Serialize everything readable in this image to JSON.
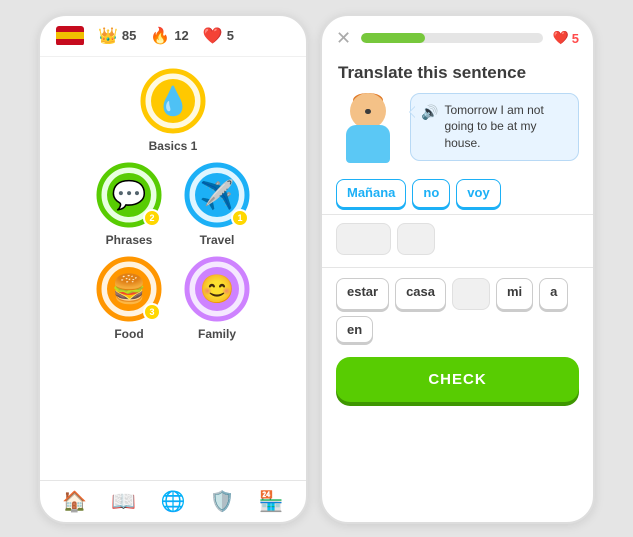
{
  "leftPhone": {
    "topBar": {
      "stats": [
        {
          "id": "xp",
          "icon": "👑",
          "value": "85",
          "iconClass": "crown-icon"
        },
        {
          "id": "streak",
          "icon": "🔥",
          "value": "12",
          "iconClass": "fire-icon"
        },
        {
          "id": "hearts",
          "icon": "❤️",
          "value": "5",
          "iconClass": "heart-icon"
        }
      ]
    },
    "lessons": [
      {
        "row": 1,
        "items": [
          {
            "id": "basics1",
            "name": "Basics 1",
            "icon": "💧",
            "color": "#ffc800",
            "ringColor": "#ffc800",
            "badge": null,
            "single": true
          }
        ]
      },
      {
        "row": 2,
        "items": [
          {
            "id": "phrases",
            "name": "Phrases",
            "icon": "💬",
            "color": "#58cc02",
            "ringColor": "#58cc02",
            "badge": "2"
          },
          {
            "id": "travel",
            "name": "Travel",
            "icon": "✈️",
            "color": "#1cb0f6",
            "ringColor": "#1cb0f6",
            "badge": "1"
          }
        ]
      },
      {
        "row": 3,
        "items": [
          {
            "id": "food",
            "name": "Food",
            "icon": "🍔",
            "color": "#ff9600",
            "ringColor": "#ff9600",
            "badge": "3"
          },
          {
            "id": "family",
            "name": "Family",
            "icon": "😊",
            "color": "#ce82ff",
            "ringColor": "#ce82ff",
            "badge": null
          }
        ]
      }
    ],
    "nav": [
      {
        "id": "home",
        "icon": "🏠",
        "active": true
      },
      {
        "id": "books",
        "icon": "📖",
        "active": false
      },
      {
        "id": "globe",
        "icon": "🌐",
        "active": false
      },
      {
        "id": "shield",
        "icon": "🛡️",
        "active": false
      },
      {
        "id": "shop",
        "icon": "🏪",
        "active": false
      }
    ]
  },
  "rightPhone": {
    "progressPercent": 35,
    "hearts": "5",
    "title": "Translate this sentence",
    "speechText": "Tomorrow I am not going to be at my house.",
    "selectedWords": [
      {
        "id": "manana",
        "text": "Mañana",
        "selected": true
      },
      {
        "id": "no",
        "text": "no",
        "selected": true
      },
      {
        "id": "voy",
        "text": "voy",
        "selected": true
      }
    ],
    "emptySlots": [
      {
        "id": "slot1",
        "size": "normal"
      },
      {
        "id": "slot2",
        "size": "small"
      }
    ],
    "wordBank": [
      {
        "id": "estar",
        "text": "estar"
      },
      {
        "id": "casa",
        "text": "casa"
      },
      {
        "id": "slot3",
        "text": "",
        "empty": true
      },
      {
        "id": "mi",
        "text": "mi"
      },
      {
        "id": "a",
        "text": "a"
      },
      {
        "id": "en",
        "text": "en"
      }
    ],
    "checkButton": "CHECK"
  }
}
